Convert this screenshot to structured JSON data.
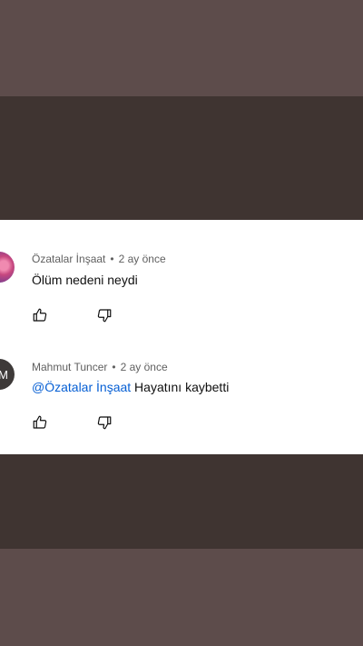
{
  "comments": [
    {
      "author": "Özatalar İnşaat",
      "separator": "•",
      "time": "2 ay önce",
      "text": "Ölüm nedeni neydi",
      "avatar_icon": "gradient-avatar"
    },
    {
      "author": "Mahmut Tuncer",
      "separator": "•",
      "time": "2 ay önce",
      "mention": "@Özatalar İnşaat",
      "text": "Hayatını kaybetti",
      "avatar_initial": "M"
    }
  ],
  "icons": {
    "like": "thumbs-up-icon",
    "dislike": "thumbs-down-icon"
  },
  "colors": {
    "mention": "#065fd4",
    "card": "#ffffff",
    "dark_band": "#3f3431",
    "outer_band": "#5d4c4b"
  }
}
